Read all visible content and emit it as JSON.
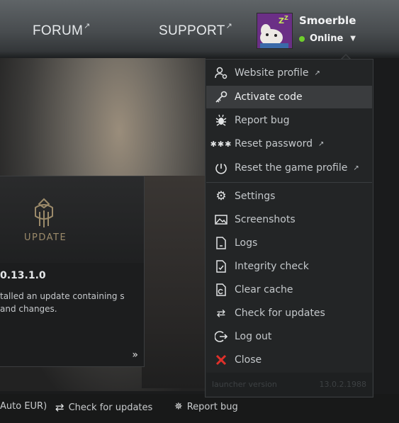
{
  "nav": {
    "forum": "FORUM",
    "support": "SUPPORT"
  },
  "user": {
    "name": "Smoerble",
    "status": "Online",
    "status_color": "#6fcf2c"
  },
  "news": {
    "badge": "UPDATE",
    "version": "0.13.1.0",
    "text": "talled an update containing s and changes.",
    "more": "»"
  },
  "footer": {
    "currency": "Auto EUR)",
    "check_updates": "Check for updates",
    "report_bug": "Report bug"
  },
  "menu": {
    "items": [
      {
        "label": "Website profile",
        "icon": "user-gear-icon",
        "external": true
      },
      {
        "label": "Activate code",
        "icon": "key-icon",
        "external": false
      },
      {
        "label": "Report bug",
        "icon": "bug-icon",
        "external": false
      },
      {
        "label": "Reset password",
        "icon": "password-dots-icon",
        "external": true
      },
      {
        "label": "Reset the game profile",
        "icon": "reset-power-icon",
        "external": true
      },
      {
        "label": "Settings",
        "icon": "gear-icon",
        "external": false
      },
      {
        "label": "Screenshots",
        "icon": "image-icon",
        "external": false
      },
      {
        "label": "Logs",
        "icon": "log-file-icon",
        "external": false
      },
      {
        "label": "Integrity check",
        "icon": "check-file-icon",
        "external": false
      },
      {
        "label": "Clear cache",
        "icon": "clear-cache-icon",
        "external": false
      },
      {
        "label": "Check for updates",
        "icon": "refresh-icon",
        "external": false
      },
      {
        "label": "Log out",
        "icon": "logout-icon",
        "external": false
      },
      {
        "label": "Close",
        "icon": "close-icon",
        "external": false
      }
    ],
    "active_item": "Activate code",
    "footer_label": "launcher version",
    "footer_version": "13.0.2.1988"
  },
  "colors": {
    "close_red": "#e0302a",
    "accent_gold": "#9b8a6a"
  }
}
